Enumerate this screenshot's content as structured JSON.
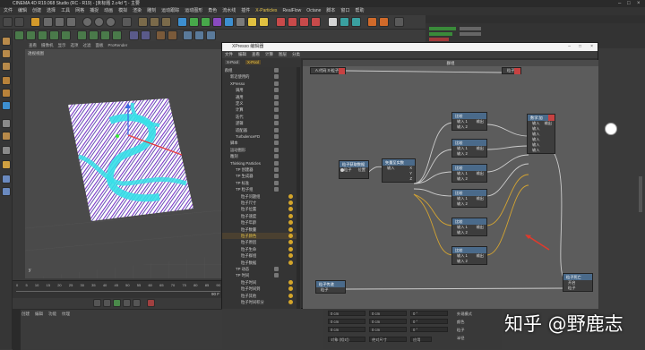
{
  "window": {
    "title": "CINEMA 4D R19.068 Studio (RC - R19) - [未标题 2.c4d *] - 主要"
  },
  "menu": [
    "文件",
    "编辑",
    "创建",
    "选择",
    "工具",
    "网格",
    "捕捉",
    "动画",
    "模拟",
    "渲染",
    "雕刻",
    "运动跟踪",
    "运动图形",
    "角色",
    "流水线",
    "插件",
    "X-Particles",
    "RealFlow",
    "Octane",
    "脚本",
    "窗口",
    "帮助"
  ],
  "menu_highlight": "X-Particles",
  "viewport": {
    "header": [
      "查看",
      "摄像机",
      "显示",
      "选项",
      "过滤",
      "面板",
      "ProRender"
    ],
    "label": "透视视图"
  },
  "timeline": {
    "ticks": [
      "0",
      "5",
      "10",
      "15",
      "20",
      "25",
      "30",
      "35",
      "40",
      "45",
      "50",
      "55",
      "60",
      "65",
      "70",
      "75",
      "80",
      "85",
      "90"
    ],
    "frame": "90 F"
  },
  "bottom_left": {
    "tabs": [
      "创建",
      "编辑",
      "功能",
      "纹理"
    ]
  },
  "xpresso": {
    "title": "XPresso 编辑器",
    "menu": [
      "文件",
      "编辑",
      "查看",
      "计算",
      "图层",
      "分类"
    ],
    "tabs": [
      "X-Pool",
      "X-Pool"
    ],
    "graph_title": "群组",
    "tree": [
      {
        "label": "群组",
        "indent": 0
      },
      {
        "label": "新近使用的",
        "indent": 2
      },
      {
        "label": "XPresso",
        "indent": 2
      },
      {
        "label": "调用",
        "indent": 4
      },
      {
        "label": "通用",
        "indent": 4
      },
      {
        "label": "定义",
        "indent": 4
      },
      {
        "label": "计算",
        "indent": 4
      },
      {
        "label": "迭代",
        "indent": 4
      },
      {
        "label": "逻辑",
        "indent": 4
      },
      {
        "label": "适配器",
        "indent": 4
      },
      {
        "label": "TurbulenceFD",
        "indent": 4
      },
      {
        "label": "脚本",
        "indent": 2
      },
      {
        "label": "运动图形",
        "indent": 2
      },
      {
        "label": "雕刻",
        "indent": 2
      },
      {
        "label": "Thinking Particles",
        "indent": 2
      },
      {
        "label": "TP 创建器",
        "indent": 4
      },
      {
        "label": "TP 生成器",
        "indent": 4
      },
      {
        "label": "TP 标准",
        "indent": 4
      },
      {
        "label": "TP 粒子组",
        "indent": 4
      },
      {
        "label": "粒子问题组",
        "indent": 6
      },
      {
        "label": "粒子尺寸",
        "indent": 6
      },
      {
        "label": "粒子位置",
        "indent": 6
      },
      {
        "label": "粒子速度",
        "indent": 6
      },
      {
        "label": "粒子年龄",
        "indent": 6
      },
      {
        "label": "粒子数量",
        "indent": 6
      },
      {
        "label": "粒子颜色",
        "indent": 6
      },
      {
        "label": "粒子原因",
        "indent": 6
      },
      {
        "label": "粒子生命",
        "indent": 6
      },
      {
        "label": "粒子群组",
        "indent": 6
      },
      {
        "label": "粒子数据",
        "indent": 6
      },
      {
        "label": "TP 动态",
        "indent": 4
      },
      {
        "label": "TP 时间",
        "indent": 4
      },
      {
        "label": "粒子时间",
        "indent": 6
      },
      {
        "label": "粒子时间到",
        "indent": 6
      },
      {
        "label": "粒子其他",
        "indent": 6
      },
      {
        "label": "粒子时间积分",
        "indent": 6
      }
    ],
    "nodes": {
      "top": {
        "title": "A.代码 X-粒子",
        "out": "粒子"
      },
      "top_right": {
        "title": "粒子"
      },
      "get_data": {
        "title": "粒子获取数据",
        "in": "粒子",
        "out": "位置"
      },
      "vec": {
        "title": "矢量至实数",
        "in": "输入",
        "outs": [
          "X",
          "Y",
          "Z"
        ]
      },
      "cmp_labels": [
        "比较",
        "比较",
        "比较",
        "比较",
        "比较",
        "比较"
      ],
      "cmp_in1": "输入 1",
      "cmp_in2": "输入 2",
      "cmp_out": "输出",
      "logic": {
        "title": "数学:加",
        "in": [
          "输入",
          "输入",
          "输入",
          "输入",
          "输入",
          "输入"
        ],
        "out": "输出"
      },
      "pass": {
        "title": "粒子传递",
        "in": "粒子",
        "out": "粒子"
      },
      "set": {
        "title": "粒子死亡",
        "ins": [
          "开启",
          "粒子"
        ]
      }
    }
  },
  "watermark": "知乎 @野鹿志",
  "attributes": {
    "fields": [
      "0 cm",
      "0 cm",
      "0 cm",
      "0 cm",
      "0 cm",
      "0 cm",
      "0 °",
      "0 °",
      "0 °"
    ],
    "selects": [
      "对象 (相对)",
      "绝对尺寸",
      "应用"
    ],
    "right_labels": [
      "外观模式",
      "颜色",
      "粒子",
      "半径"
    ]
  },
  "colors": {
    "node_header": "#4a6a8a",
    "port_tag": "#c74242",
    "wire_yellow": "#d4a431",
    "arrow": "#e03a2c"
  }
}
